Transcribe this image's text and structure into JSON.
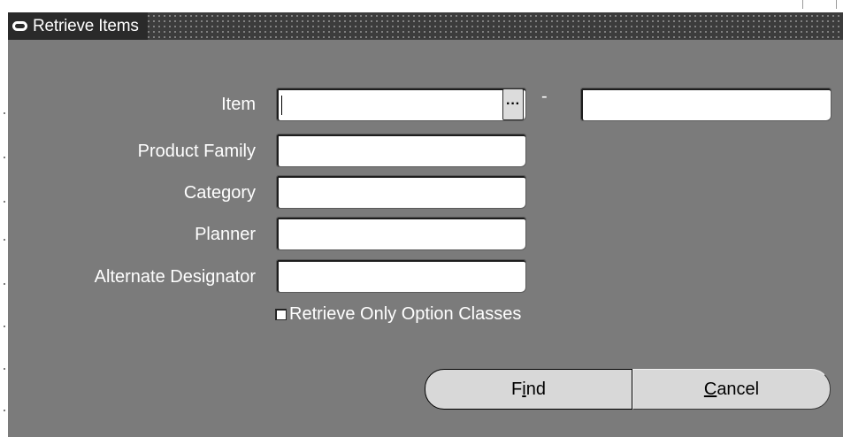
{
  "window": {
    "title": "Retrieve Items",
    "icon": "window-icon"
  },
  "form": {
    "item": {
      "label": "Item",
      "value": "",
      "range_separator": "-",
      "to_value": "",
      "lov_button_label": "···"
    },
    "product_family": {
      "label": "Product Family",
      "value": ""
    },
    "category": {
      "label": "Category",
      "value": ""
    },
    "planner": {
      "label": "Planner",
      "value": ""
    },
    "alternate_designator": {
      "label": "Alternate Designator",
      "value": ""
    },
    "retrieve_only_option_classes": {
      "label": "Retrieve Only Option Classes",
      "checked": false
    }
  },
  "buttons": {
    "find": {
      "pre": "F",
      "mnemonic": "i",
      "post": "nd"
    },
    "cancel": {
      "pre": "",
      "mnemonic": "C",
      "post": "ancel"
    }
  },
  "colors": {
    "client_background": "#7b7b7b",
    "titlebar": "#3c3c3c",
    "button_face": "#d8d8d8"
  }
}
